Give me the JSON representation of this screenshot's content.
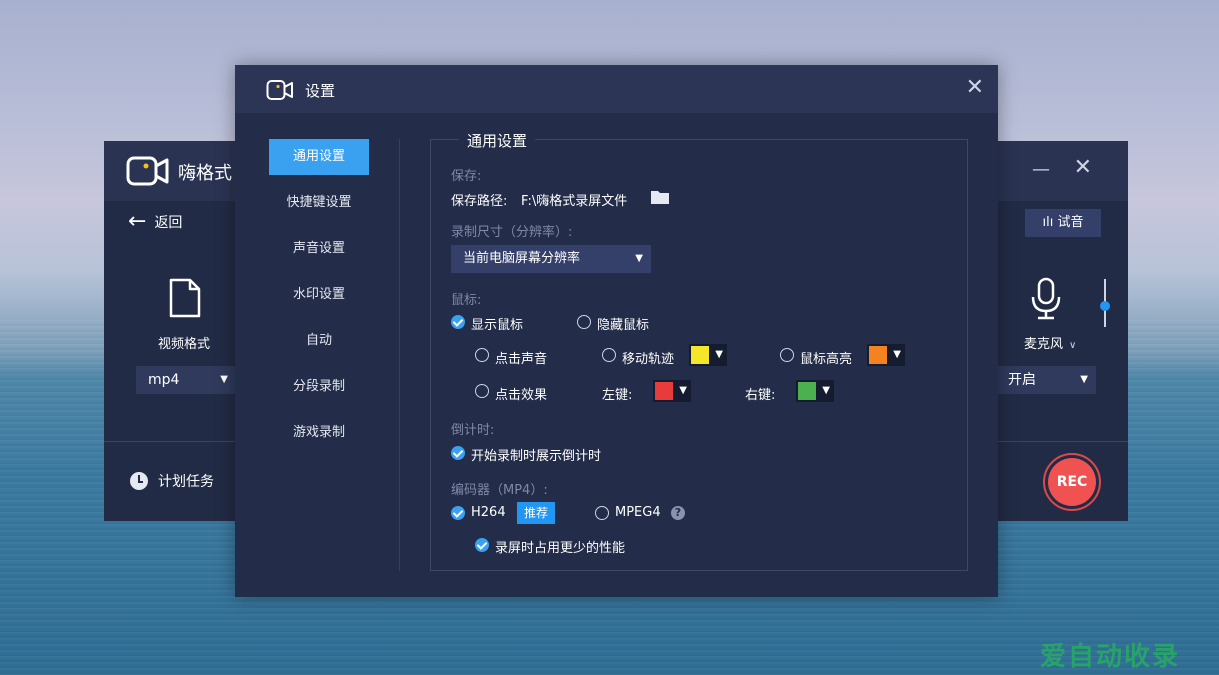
{
  "app": {
    "title": "嗨格式",
    "back_label": "返回",
    "format": {
      "label": "视频格式",
      "value": "mp4"
    },
    "schedule_label": "计划任务",
    "trial_button": "试音",
    "mic": {
      "label": "麦克风",
      "value": "开启"
    },
    "rec_label": "REC"
  },
  "dialog": {
    "title": "设置",
    "nav": [
      {
        "label": "通用设置",
        "active": true
      },
      {
        "label": "快捷键设置",
        "active": false
      },
      {
        "label": "声音设置",
        "active": false
      },
      {
        "label": "水印设置",
        "active": false
      },
      {
        "label": "自动",
        "active": false
      },
      {
        "label": "分段录制",
        "active": false
      },
      {
        "label": "游戏录制",
        "active": false
      }
    ],
    "panel": {
      "title": "通用设置",
      "save_section": "保存:",
      "save_path_label": "保存路径:",
      "save_path_value": "F:\\嗨格式录屏文件",
      "size_section": "录制尺寸（分辨率）:",
      "size_value": "当前电脑屏幕分辨率",
      "mouse_section": "鼠标:",
      "show_mouse": "显示鼠标",
      "hide_mouse": "隐藏鼠标",
      "click_sound": "点击声音",
      "move_track": "移动轨迹",
      "mouse_highlight": "鼠标高亮",
      "click_effect": "点击效果",
      "left_key": "左键:",
      "right_key": "右键:",
      "countdown_section": "倒计时:",
      "countdown_option": "开始录制时展示倒计时",
      "encoder_section": "编码器（MP4）:",
      "h264": "H264",
      "recommend_badge": "推荐",
      "mpeg4": "MPEG4",
      "help_glyph": "?",
      "low_perf": "录屏时占用更少的性能"
    },
    "colors": {
      "move_track": "#f5e62a",
      "mouse_highlight": "#f58220",
      "left_key": "#e83b3b",
      "right_key": "#4caf50",
      "accent": "#3aa0f0"
    }
  },
  "watermark_text": "爱自动收录"
}
